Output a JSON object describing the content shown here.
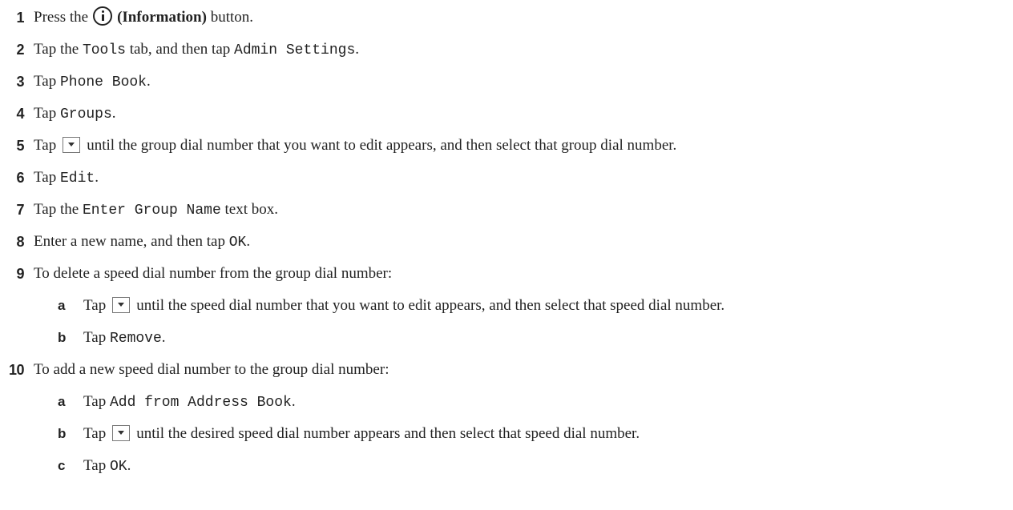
{
  "steps": [
    {
      "num": "1",
      "pre": "Press the",
      "icon": "information-icon",
      "bold": "(Information)",
      "post": " button."
    },
    {
      "num": "2",
      "pre": "Tap the ",
      "code1": "Tools",
      "mid": " tab, and then tap ",
      "code2": "Admin Settings",
      "post": "."
    },
    {
      "num": "3",
      "pre": "Tap ",
      "code1": "Phone Book",
      "post": "."
    },
    {
      "num": "4",
      "pre": "Tap ",
      "code1": "Groups",
      "post": "."
    },
    {
      "num": "5",
      "pre": "Tap",
      "icon": "down-arrow-button",
      "post": "until the group dial number that you want to edit appears, and then select that group dial number."
    },
    {
      "num": "6",
      "pre": "Tap ",
      "code1": "Edit",
      "post": "."
    },
    {
      "num": "7",
      "pre": "Tap the ",
      "code1": "Enter Group Name",
      "post": " text box."
    },
    {
      "num": "8",
      "pre": "Enter a new name, and then tap ",
      "code1": "OK",
      "post": "."
    },
    {
      "num": "9",
      "text": "To delete a speed dial number from the group dial number:"
    },
    {
      "num": "a",
      "pre": "Tap",
      "icon": "down-arrow-button",
      "post": "until the speed dial number that you want to edit appears, and then select that speed dial number."
    },
    {
      "num": "b",
      "pre": "Tap ",
      "code1": "Remove",
      "post": "."
    },
    {
      "num": "10",
      "text": "To add a new speed dial number to the group dial number:"
    },
    {
      "num": "a",
      "pre": "Tap ",
      "code1": "Add from Address Book",
      "post": "."
    },
    {
      "num": "b",
      "pre": "Tap",
      "icon": "down-arrow-button",
      "post": "until the desired speed dial number appears and then select that speed dial number."
    },
    {
      "num": "c",
      "pre": "Tap ",
      "code1": "OK",
      "post": "."
    }
  ]
}
